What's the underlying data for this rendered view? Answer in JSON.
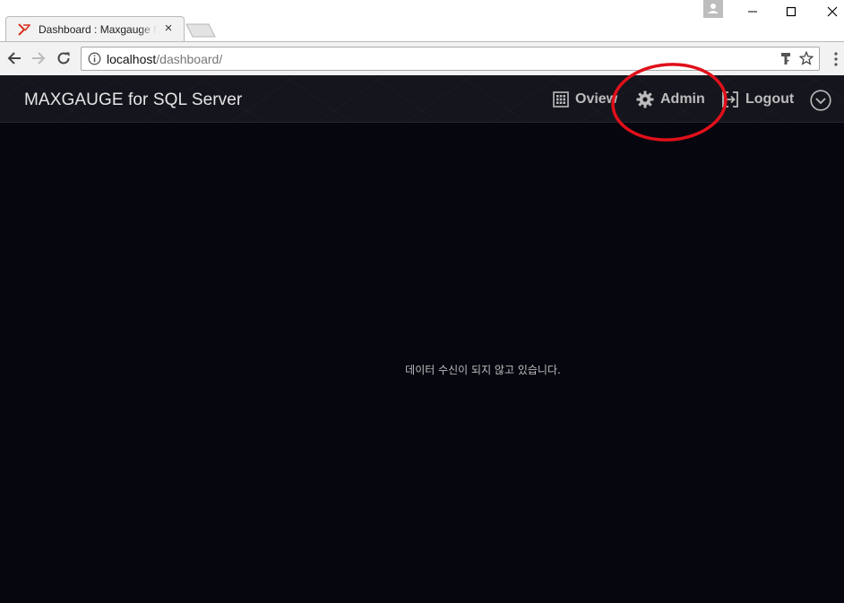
{
  "browser": {
    "tab": {
      "title": "Dashboard : Maxgauge for SQL Server",
      "close_glyph": "×"
    },
    "address": {
      "host": "localhost",
      "path": "/dashboard/"
    },
    "icons": {
      "back": "arrow-left-icon",
      "forward": "arrow-right-icon",
      "reload": "reload-icon",
      "info": "info-icon",
      "key": "key-icon",
      "bookmark": "star-icon",
      "menu": "more-vert-icon",
      "profile": "person-icon"
    }
  },
  "header": {
    "title": "MAXGAUGE for SQL Server",
    "nav": [
      {
        "label": "Oview",
        "icon": "grid-icon"
      },
      {
        "label": "Admin",
        "icon": "gear-icon"
      },
      {
        "label": "Logout",
        "icon": "logout-icon"
      }
    ],
    "expand_icon": "chevron-down-circle-icon"
  },
  "main": {
    "empty_message": "데이터 수신이 되지 않고 있습니다."
  },
  "colors": {
    "app_background": "#05060e",
    "header_background": "#15161d",
    "header_text": "#e6e6e6",
    "nav_text": "#bcbcbc",
    "annotation": "#e0101a",
    "tab_background": "#f2f2f2"
  }
}
